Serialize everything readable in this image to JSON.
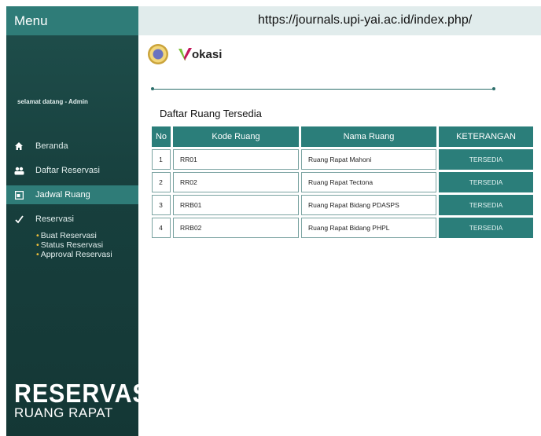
{
  "sidebar": {
    "menu_title": "Menu",
    "welcome": "selamat datang - Admin",
    "items": [
      {
        "label": "Beranda",
        "icon": "home-icon"
      },
      {
        "label": "Daftar Reservasi",
        "icon": "users-icon"
      },
      {
        "label": "Jadwal Ruang",
        "icon": "calendar-icon",
        "active": true
      },
      {
        "label": "Reservasi",
        "icon": "checkmark-icon"
      }
    ],
    "subitems": [
      "Buat Reservasi",
      "Status Reservasi",
      "Approval Reservasi"
    ],
    "brand_title": "RESERVASI",
    "brand_subtitle": "RUANG RAPAT"
  },
  "topbar": {
    "url": "https://journals.upi-yai.ac.id/index.php/"
  },
  "logos": {
    "vokasi": "okasi"
  },
  "main": {
    "title": "Daftar Ruang Tersedia",
    "columns": [
      "No",
      "Kode Ruang",
      "Nama Ruang",
      "KETERANGAN"
    ],
    "rows": [
      {
        "no": "1",
        "kode": "RR01",
        "nama": "Ruang Rapat Mahoni",
        "status": "TERSEDIA"
      },
      {
        "no": "2",
        "kode": "RR02",
        "nama": "Ruang Rapat Tectona",
        "status": "TERSEDIA"
      },
      {
        "no": "3",
        "kode": "RRB01",
        "nama": "Ruang Rapat Bidang PDASPS",
        "status": "TERSEDIA"
      },
      {
        "no": "4",
        "kode": "RRB02",
        "nama": "Ruang Rapat Bidang PHPL",
        "status": "TERSEDIA"
      }
    ]
  },
  "colors": {
    "sidebar_bg": "#1f4f4c",
    "accent": "#2f7c78",
    "table_header": "#2b7e7a",
    "topbar_bg": "#e1ecec"
  }
}
